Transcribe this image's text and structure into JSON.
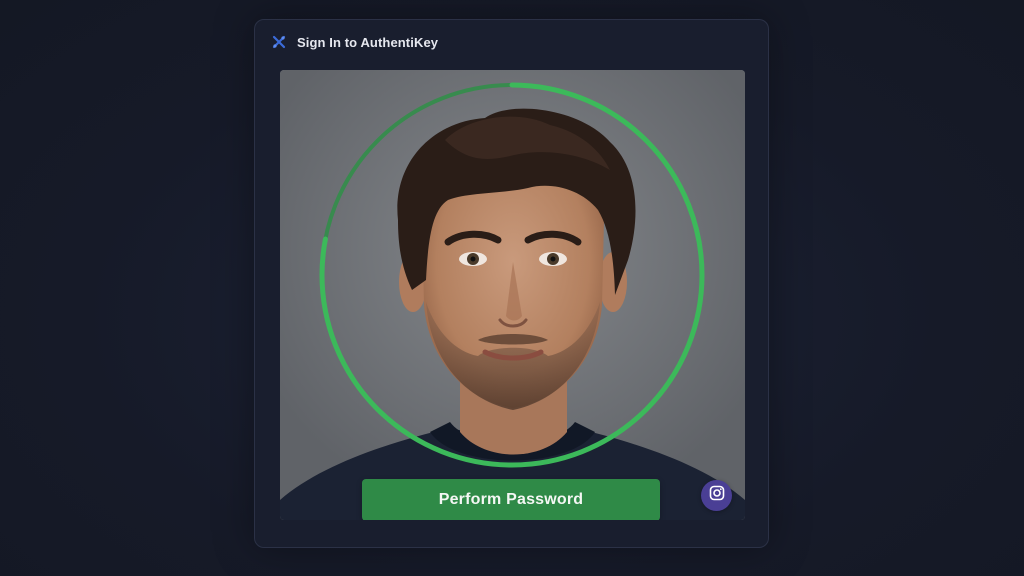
{
  "dialog": {
    "title": "Sign In to AuthentiKey",
    "app_icon": "authentikey-logo-icon"
  },
  "camera": {
    "scan_progress": 0.78,
    "ring_color": "#3cb95a",
    "ring_track_color": "#2f8f48"
  },
  "actions": {
    "primary_label": "Perform Password",
    "primary_color": "#2f8a47",
    "camera_button_icon": "camera-icon",
    "camera_button_color": "#4a3f95"
  }
}
